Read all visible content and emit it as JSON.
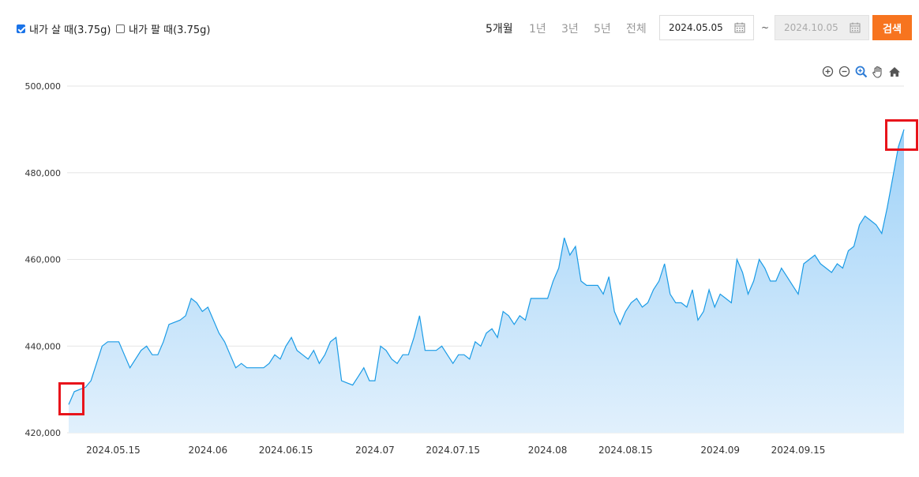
{
  "filters": {
    "buy": {
      "label": "내가 살 때(3.75g)",
      "checked": true
    },
    "sell": {
      "label": "내가 팔 때(3.75g)",
      "checked": false
    }
  },
  "periods": [
    {
      "label": "5개월",
      "active": true
    },
    {
      "label": "1년",
      "active": false
    },
    {
      "label": "3년",
      "active": false
    },
    {
      "label": "5년",
      "active": false
    },
    {
      "label": "전체",
      "active": false
    }
  ],
  "date_range": {
    "start": "2024.05.05",
    "end": "2024.10.05",
    "separator": "~"
  },
  "search_label": "검색",
  "toolbar_icons": [
    "zoom-in-icon",
    "zoom-out-icon",
    "zoom-select-icon",
    "pan-hand-icon",
    "reset-home-icon"
  ],
  "colors": {
    "accent": "#f7741f",
    "line": "#1a9be6",
    "fill_top": "#9fd2f8",
    "fill_bottom": "#e1f0fc",
    "highlight": "#e8141b"
  },
  "chart_data": {
    "type": "area",
    "ylim": [
      420000,
      500000
    ],
    "yticks": [
      {
        "value": 420000,
        "label": "420,000"
      },
      {
        "value": 440000,
        "label": "440,000"
      },
      {
        "value": 460000,
        "label": "460,000"
      },
      {
        "value": 480000,
        "label": "480,000"
      },
      {
        "value": 500000,
        "label": "500,000"
      }
    ],
    "xlim": [
      "2024-05-07",
      "2024-10-04"
    ],
    "xticks": [
      {
        "date": "2024-05-15",
        "label": "2024.05.15"
      },
      {
        "date": "2024-06-01",
        "label": "2024.06"
      },
      {
        "date": "2024-06-15",
        "label": "2024.06.15"
      },
      {
        "date": "2024-07-01",
        "label": "2024.07"
      },
      {
        "date": "2024-07-15",
        "label": "2024.07.15"
      },
      {
        "date": "2024-08-01",
        "label": "2024.08"
      },
      {
        "date": "2024-08-15",
        "label": "2024.08.15"
      },
      {
        "date": "2024-09-01",
        "label": "2024.09"
      },
      {
        "date": "2024-09-15",
        "label": "2024.09.15"
      }
    ],
    "grid": true,
    "series": [
      {
        "points": [
          [
            "2024-05-07",
            426500
          ],
          [
            "2024-05-08",
            429500
          ],
          [
            "2024-05-09",
            430000
          ],
          [
            "2024-05-10",
            430500
          ],
          [
            "2024-05-11",
            432000
          ],
          [
            "2024-05-13",
            440000
          ],
          [
            "2024-05-14",
            441000
          ],
          [
            "2024-05-15",
            441000
          ],
          [
            "2024-05-16",
            441000
          ],
          [
            "2024-05-17",
            438000
          ],
          [
            "2024-05-18",
            435000
          ],
          [
            "2024-05-20",
            439000
          ],
          [
            "2024-05-21",
            440000
          ],
          [
            "2024-05-22",
            438000
          ],
          [
            "2024-05-23",
            438000
          ],
          [
            "2024-05-24",
            441000
          ],
          [
            "2024-05-25",
            445000
          ],
          [
            "2024-05-27",
            446000
          ],
          [
            "2024-05-28",
            447000
          ],
          [
            "2024-05-29",
            451000
          ],
          [
            "2024-05-30",
            450000
          ],
          [
            "2024-05-31",
            448000
          ],
          [
            "2024-06-01",
            449000
          ],
          [
            "2024-06-03",
            443000
          ],
          [
            "2024-06-04",
            441000
          ],
          [
            "2024-06-05",
            438000
          ],
          [
            "2024-06-06",
            435000
          ],
          [
            "2024-06-07",
            436000
          ],
          [
            "2024-06-08",
            435000
          ],
          [
            "2024-06-10",
            435000
          ],
          [
            "2024-06-11",
            435000
          ],
          [
            "2024-06-12",
            436000
          ],
          [
            "2024-06-13",
            438000
          ],
          [
            "2024-06-14",
            437000
          ],
          [
            "2024-06-15",
            440000
          ],
          [
            "2024-06-16",
            442000
          ],
          [
            "2024-06-17",
            439000
          ],
          [
            "2024-06-18",
            438000
          ],
          [
            "2024-06-19",
            437000
          ],
          [
            "2024-06-20",
            439000
          ],
          [
            "2024-06-21",
            436000
          ],
          [
            "2024-06-22",
            438000
          ],
          [
            "2024-06-23",
            441000
          ],
          [
            "2024-06-24",
            442000
          ],
          [
            "2024-06-25",
            432000
          ],
          [
            "2024-06-26",
            431500
          ],
          [
            "2024-06-27",
            431000
          ],
          [
            "2024-06-28",
            433000
          ],
          [
            "2024-06-29",
            435000
          ],
          [
            "2024-06-30",
            432000
          ],
          [
            "2024-07-01",
            432000
          ],
          [
            "2024-07-02",
            440000
          ],
          [
            "2024-07-03",
            439000
          ],
          [
            "2024-07-04",
            437000
          ],
          [
            "2024-07-05",
            436000
          ],
          [
            "2024-07-06",
            438000
          ],
          [
            "2024-07-07",
            438000
          ],
          [
            "2024-07-08",
            442000
          ],
          [
            "2024-07-09",
            447000
          ],
          [
            "2024-07-10",
            439000
          ],
          [
            "2024-07-11",
            439000
          ],
          [
            "2024-07-12",
            439000
          ],
          [
            "2024-07-13",
            440000
          ],
          [
            "2024-07-14",
            438000
          ],
          [
            "2024-07-15",
            436000
          ],
          [
            "2024-07-16",
            438000
          ],
          [
            "2024-07-17",
            438000
          ],
          [
            "2024-07-18",
            437000
          ],
          [
            "2024-07-19",
            441000
          ],
          [
            "2024-07-20",
            440000
          ],
          [
            "2024-07-21",
            443000
          ],
          [
            "2024-07-22",
            444000
          ],
          [
            "2024-07-23",
            442000
          ],
          [
            "2024-07-24",
            448000
          ],
          [
            "2024-07-25",
            447000
          ],
          [
            "2024-07-26",
            445000
          ],
          [
            "2024-07-27",
            447000
          ],
          [
            "2024-07-28",
            446000
          ],
          [
            "2024-07-29",
            451000
          ],
          [
            "2024-07-30",
            451000
          ],
          [
            "2024-07-31",
            451000
          ],
          [
            "2024-08-01",
            451000
          ],
          [
            "2024-08-02",
            455000
          ],
          [
            "2024-08-03",
            458000
          ],
          [
            "2024-08-04",
            465000
          ],
          [
            "2024-08-05",
            461000
          ],
          [
            "2024-08-06",
            463000
          ],
          [
            "2024-08-07",
            455000
          ],
          [
            "2024-08-08",
            454000
          ],
          [
            "2024-08-09",
            454000
          ],
          [
            "2024-08-10",
            454000
          ],
          [
            "2024-08-11",
            452000
          ],
          [
            "2024-08-12",
            456000
          ],
          [
            "2024-08-13",
            448000
          ],
          [
            "2024-08-14",
            445000
          ],
          [
            "2024-08-15",
            448000
          ],
          [
            "2024-08-16",
            450000
          ],
          [
            "2024-08-17",
            451000
          ],
          [
            "2024-08-18",
            449000
          ],
          [
            "2024-08-19",
            450000
          ],
          [
            "2024-08-20",
            453000
          ],
          [
            "2024-08-21",
            455000
          ],
          [
            "2024-08-22",
            459000
          ],
          [
            "2024-08-23",
            452000
          ],
          [
            "2024-08-24",
            450000
          ],
          [
            "2024-08-25",
            450000
          ],
          [
            "2024-08-26",
            449000
          ],
          [
            "2024-08-27",
            453000
          ],
          [
            "2024-08-28",
            446000
          ],
          [
            "2024-08-29",
            448000
          ],
          [
            "2024-08-30",
            453000
          ],
          [
            "2024-08-31",
            449000
          ],
          [
            "2024-09-01",
            452000
          ],
          [
            "2024-09-02",
            451000
          ],
          [
            "2024-09-03",
            450000
          ],
          [
            "2024-09-04",
            460000
          ],
          [
            "2024-09-05",
            457000
          ],
          [
            "2024-09-06",
            452000
          ],
          [
            "2024-09-07",
            455000
          ],
          [
            "2024-09-08",
            460000
          ],
          [
            "2024-09-09",
            458000
          ],
          [
            "2024-09-10",
            455000
          ],
          [
            "2024-09-11",
            455000
          ],
          [
            "2024-09-12",
            458000
          ],
          [
            "2024-09-13",
            456000
          ],
          [
            "2024-09-14",
            454000
          ],
          [
            "2024-09-15",
            452000
          ],
          [
            "2024-09-16",
            459000
          ],
          [
            "2024-09-17",
            460000
          ],
          [
            "2024-09-18",
            461000
          ],
          [
            "2024-09-19",
            459000
          ],
          [
            "2024-09-20",
            458000
          ],
          [
            "2024-09-21",
            457000
          ],
          [
            "2024-09-22",
            459000
          ],
          [
            "2024-09-23",
            458000
          ],
          [
            "2024-09-24",
            462000
          ],
          [
            "2024-09-25",
            463000
          ],
          [
            "2024-09-26",
            468000
          ],
          [
            "2024-09-27",
            470000
          ],
          [
            "2024-09-28",
            469000
          ],
          [
            "2024-09-29",
            468000
          ],
          [
            "2024-09-30",
            466000
          ],
          [
            "2024-10-01",
            472000
          ],
          [
            "2024-10-02",
            479000
          ],
          [
            "2024-10-03",
            486000
          ],
          [
            "2024-10-04",
            490000
          ]
        ]
      }
    ]
  }
}
